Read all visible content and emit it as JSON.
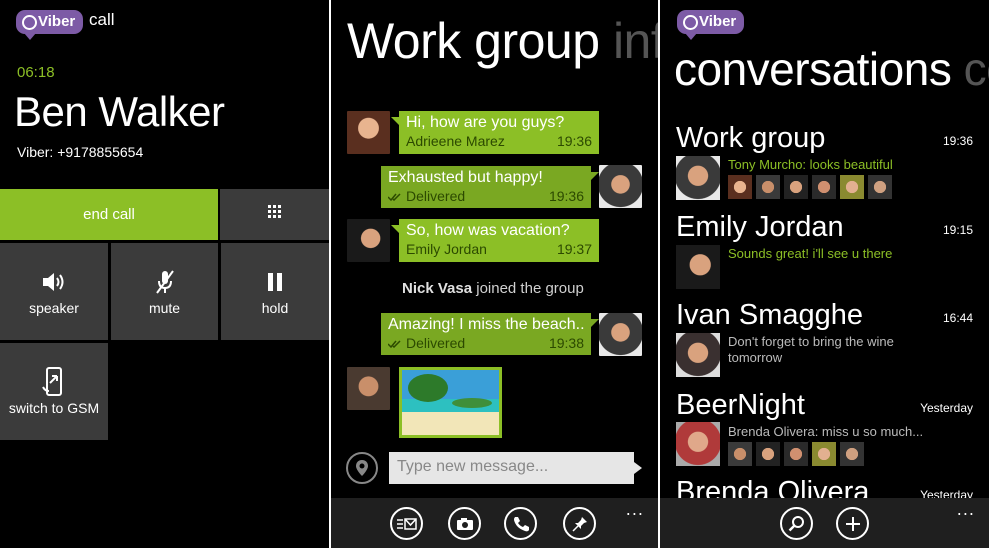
{
  "call_screen": {
    "logo": "Viber",
    "header_label": "call",
    "timer": "06:18",
    "caller_name": "Ben Walker",
    "caller_number": "Viber: +9178855654",
    "buttons": {
      "end_call": "end call",
      "speaker": "speaker",
      "mute": "mute",
      "hold": "hold",
      "switch_gsm": "switch to GSM"
    },
    "icons": {
      "keypad": "keypad-icon",
      "speaker": "speaker-icon",
      "mute": "mic-muted-icon",
      "hold": "pause-icon",
      "switch": "phone-switch-icon"
    },
    "accent_color": "#8cbf26",
    "tile_color": "#3b3b3b"
  },
  "chat_screen": {
    "title": "Work group",
    "pivot_next": "info",
    "messages": [
      {
        "side": "left",
        "text": "Hi, how are you guys?",
        "sender": "Adrieene Marez",
        "time": "19:36"
      },
      {
        "side": "right",
        "text": "Exhausted but happy!",
        "status": "Delivered",
        "time": "19:36"
      },
      {
        "side": "left",
        "text": "So, how was vacation?",
        "sender": "Emily Jordan",
        "time": "19:37"
      },
      {
        "side": "right",
        "text": "Amazing! I miss the beach...",
        "status": "Delivered",
        "time": "19:38"
      }
    ],
    "system_message": {
      "name": "Nick Vasa",
      "text": " joined the group"
    },
    "input_placeholder": "Type new message...",
    "appbar_icons": [
      "compose-message-icon",
      "camera-icon",
      "call-icon",
      "pin-icon"
    ],
    "more": "..."
  },
  "conversations_screen": {
    "logo": "Viber",
    "title": "conversations",
    "pivot_next": "co",
    "items": [
      {
        "name": "Work group",
        "time": "19:36",
        "preview": "Tony Murcho: looks beautiful",
        "preview_color": "green"
      },
      {
        "name": "Emily Jordan",
        "time": "19:15",
        "preview": "Sounds great! i'll see u there",
        "preview_color": "green"
      },
      {
        "name": "Ivan Smagghe",
        "time": "16:44",
        "preview": "Don't forget to bring the wine",
        "preview2": "tomorrow",
        "preview_color": "gray"
      },
      {
        "name": "BeerNight",
        "time": "Yesterday",
        "preview": "Brenda Olivera: miss u so much...",
        "preview_color": "gray"
      },
      {
        "name": "Brenda Olivera",
        "time": "Yesterday"
      }
    ],
    "appbar_icons": [
      "search-icon",
      "add-icon"
    ],
    "more": "..."
  }
}
